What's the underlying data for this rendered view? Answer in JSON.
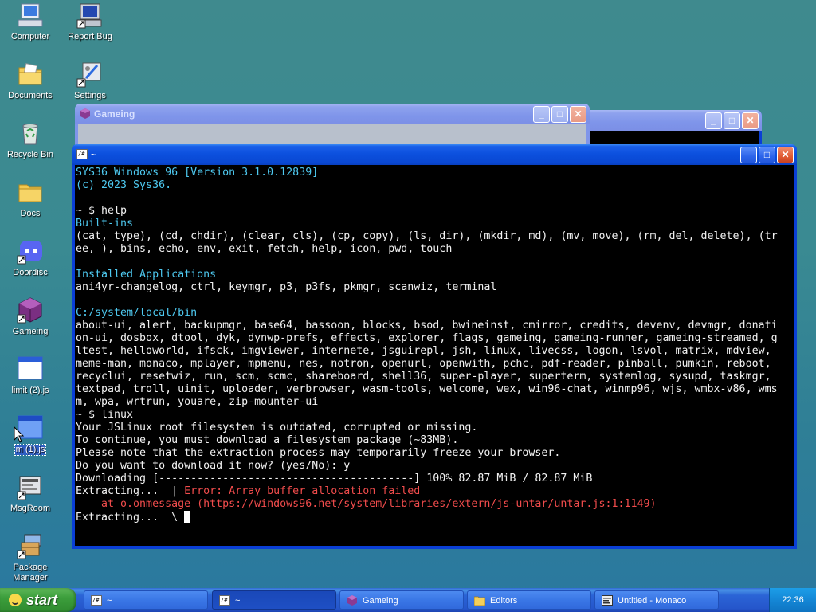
{
  "desktop": {
    "icons": [
      {
        "label": "Computer"
      },
      {
        "label": "Report Bug"
      },
      {
        "label": "Documents"
      },
      {
        "label": "Settings"
      },
      {
        "label": "Recycle Bin"
      },
      {
        "label": "Docs"
      },
      {
        "label": "Doordisc"
      },
      {
        "label": "Gameing"
      },
      {
        "label": "limit (2).js"
      },
      {
        "label": "m (1).js"
      },
      {
        "label": "MsgRoom"
      },
      {
        "label": "Package Manager"
      }
    ]
  },
  "windows": {
    "gameing": {
      "title": "Gameing"
    },
    "background": {
      "title": ""
    },
    "terminal": {
      "title": "~",
      "lines": [
        {
          "text": "SYS36 Windows 96 [Version 3.1.0.12839]",
          "style": "cyan"
        },
        {
          "text": "(c) 2023 Sys36.",
          "style": "cyan"
        },
        {
          "text": "",
          "style": ""
        },
        {
          "text": "~ $ help",
          "style": ""
        },
        {
          "text": "Built-ins",
          "style": "cyan"
        },
        {
          "text": "(cat, type), (cd, chdir), (clear, cls), (cp, copy), (ls, dir), (mkdir, md), (mv, move), (rm, del, delete), (tr",
          "style": ""
        },
        {
          "text": "ee, ), bins, echo, env, exit, fetch, help, icon, pwd, touch",
          "style": ""
        },
        {
          "text": "",
          "style": ""
        },
        {
          "text": "Installed Applications",
          "style": "cyan"
        },
        {
          "text": "ani4yr-changelog, ctrl, keymgr, p3, p3fs, pkmgr, scanwiz, terminal",
          "style": ""
        },
        {
          "text": "",
          "style": ""
        },
        {
          "text": "C:/system/local/bin",
          "style": "cyan"
        },
        {
          "text": "about-ui, alert, backupmgr, base64, bassoon, blocks, bsod, bwineinst, cmirror, credits, devenv, devmgr, donati",
          "style": ""
        },
        {
          "text": "on-ui, dosbox, dtool, dyk, dynwp-prefs, effects, explorer, flags, gameing, gameing-runner, gameing-streamed, g",
          "style": ""
        },
        {
          "text": "ltest, helloworld, ifsck, imgviewer, internete, jsguirepl, jsh, linux, livecss, logon, lsvol, matrix, mdview,",
          "style": ""
        },
        {
          "text": "meme-man, monaco, mplayer, mpmenu, nes, notron, openurl, openwith, pchc, pdf-reader, pinball, pumkin, reboot,",
          "style": ""
        },
        {
          "text": "recyclui, resetwiz, run, scm, scmc, shareboard, shell36, super-player, superterm, systemlog, sysupd, taskmgr,",
          "style": ""
        },
        {
          "text": "textpad, troll, uinit, uploader, verbrowser, wasm-tools, welcome, wex, win96-chat, winmp96, wjs, wmbx-v86, wms",
          "style": ""
        },
        {
          "text": "m, wpa, wrtrun, youare, zip-mounter-ui",
          "style": ""
        },
        {
          "text": "~ $ linux",
          "style": ""
        },
        {
          "text": "Your JSLinux root filesystem is outdated, corrupted or missing.",
          "style": ""
        },
        {
          "text": "To continue, you must download a filesystem package (~83MB).",
          "style": ""
        },
        {
          "text": "Please note that the extraction process may temporarily freeze your browser.",
          "style": ""
        },
        {
          "text": "Do you want to download it now? (yes/No): y",
          "style": ""
        },
        {
          "text": "Downloading [----------------------------------------] 100% 82.87 MiB / 82.87 MiB",
          "style": ""
        }
      ],
      "error_prefix": "Extracting...  | ",
      "error_text": "Error: Array buffer allocation failed",
      "error_trace": "    at o.onmessage (https://windows96.net/system/libraries/extern/js-untar/untar.js:1:1149)",
      "current_line": "Extracting...  \\ "
    }
  },
  "taskbar": {
    "start_label": "start",
    "tasks": [
      {
        "label": "~"
      },
      {
        "label": "~"
      },
      {
        "label": "Gameing"
      },
      {
        "label": "Editors"
      },
      {
        "label": "Untitled - Monaco"
      }
    ],
    "clock": "22:36"
  },
  "colors": {
    "accent_blue": "#0a48d2",
    "terminal_cyan": "#4ec9f0",
    "terminal_error": "#f14c4c"
  }
}
